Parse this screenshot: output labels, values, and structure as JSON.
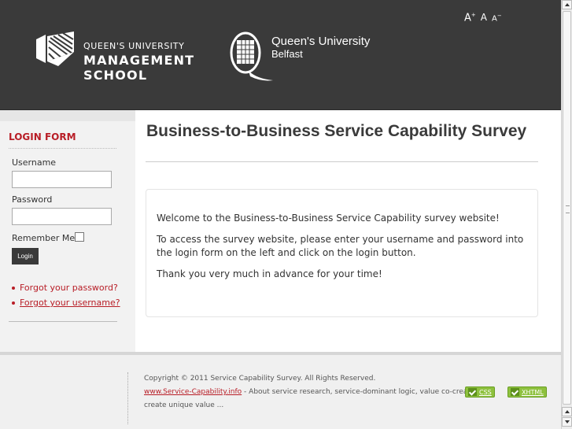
{
  "header": {
    "font_controls": {
      "large": "A",
      "large_mod": "+",
      "normal": "A",
      "small": "A",
      "small_mod": "−"
    },
    "qums_logo": {
      "line1": "QUEEN'S UNIVERSITY",
      "line2": "MANAGEMENT",
      "line3": "SCHOOL"
    },
    "qub_logo": {
      "line1": "Queen's University",
      "line2": "Belfast"
    }
  },
  "sidebar": {
    "title": "LOGIN FORM",
    "username_label": "Username",
    "username_value": "",
    "password_label": "Password",
    "password_value": "",
    "remember_label": "Remember Me",
    "remember_checked": false,
    "login_button": "Login",
    "links": [
      {
        "label": "Forgot your password?"
      },
      {
        "label": "Forgot your username?"
      }
    ]
  },
  "main": {
    "title": "Business-to-Business Service Capability Survey",
    "paragraphs": [
      "Welcome to the Business-to-Business Service Capability survey website!",
      "To access the survey website, please enter your username and password into the login form on the left and click on the login button.",
      "Thank you very much in advance for your time!"
    ]
  },
  "footer": {
    "copyright": "Copyright © 2011 Service Capability Survey. All Rights Reserved.",
    "link": "www.Service-Capability.info",
    "desc": " - About service research, service-dominant logic, value co-creation",
    "line3": "create unique value ...",
    "badges": {
      "css": "CSS",
      "xhtml": "XHTML"
    }
  },
  "colors": {
    "header_bg": "#3a3a3a",
    "accent_red": "#b81d26",
    "sidebar_bg": "#f2f2f2",
    "footer_bg": "#f0f0f0",
    "badge_green": "#8ec13e"
  },
  "icons": [
    "qums-crest-icon",
    "qub-crest-icon",
    "checkmark-icon",
    "scroll-up-arrow-icon",
    "scroll-down-arrow-icon"
  ]
}
